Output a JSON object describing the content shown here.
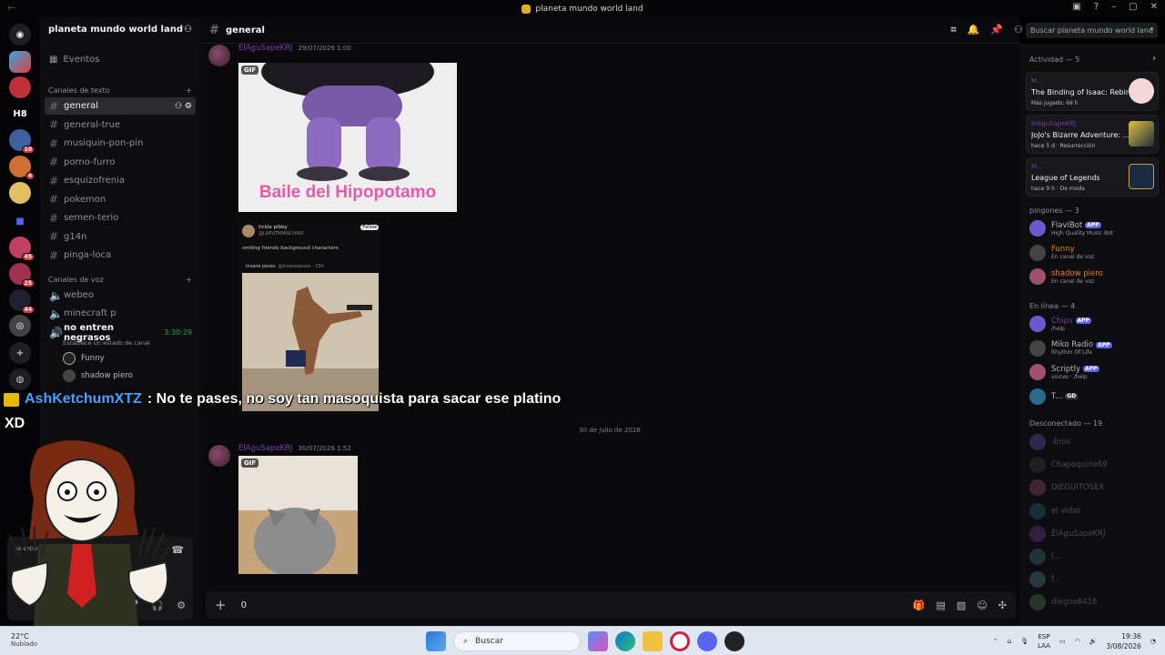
{
  "window": {
    "title": "planeta mundo world land"
  },
  "server": {
    "name": "planeta mundo world land",
    "events_label": "Eventos",
    "text_category": "Canales de texto",
    "voice_category": "Canales de voz",
    "text_channels": [
      "general",
      "general-true",
      "musiquin-pon-pin",
      "porno-furro",
      "esquizofrenia",
      "pokemon",
      "semen-terio",
      "g14n",
      "pinga-loca"
    ],
    "voice_channels": [
      "webeo",
      "minecraft p",
      "no entren negrasos"
    ],
    "active_voice": {
      "name": "no entren negrasos",
      "timer": "3:30:29",
      "status_hint": "Establece un estado de canal",
      "users": [
        "Funny",
        "shadow piero"
      ]
    },
    "rail_labels": {
      "h8": "H8",
      "b10": "10",
      "b4": "4",
      "b45": "45",
      "b25": "25",
      "b44": "44"
    }
  },
  "channel_header": {
    "name": "general",
    "search_placeholder": "Buscar planeta mundo world land"
  },
  "messages": [
    {
      "author": "ElAguSapeKRJ",
      "timestamp": "29/07/2026 1:00",
      "gif_label": "GIF",
      "gif_caption": "Baile del Hipopotamo"
    },
    {
      "embed_user": "tickle pibby",
      "embed_handle": "@LAPUTAPANCHIKO",
      "embed_text": "smiling friends background characters",
      "embed_quote_user": "insane poses",
      "embed_quote_handle": "@insaneposes · 23h",
      "follow": "Follow"
    },
    {
      "date_divider": "30 de julio de 2026"
    },
    {
      "author": "ElAguSapeKRJ",
      "timestamp": "30/07/2026 1:52",
      "gif_label": "GIF"
    }
  ],
  "composer": {
    "value": "0"
  },
  "overlay": {
    "user": "AshKetchumXTZ",
    "message": ": No te pases, no soy tan masoquista para sacar ese platino",
    "second_line": "XD"
  },
  "user_panel": {
    "channel_line": "no entren ... mundo"
  },
  "activity": {
    "header": "Actividad — 5",
    "cards": [
      {
        "who": "M...",
        "game": "The Binding of Isaac: Rebirth",
        "sub": "Más jugado: 66 h"
      },
      {
        "who": "ElAguSapeKRJ",
        "game": "JoJo's Bizarre Adventure: ...",
        "sub": "hace 5 d  ·  Resurrección"
      },
      {
        "who": "M...",
        "game": "League of Legends",
        "sub": "hace 9 h  ·  De moda"
      }
    ]
  },
  "member_groups": {
    "pingones_header": "pingones — 3",
    "pingones": [
      {
        "name": "FlaviBot",
        "status": "High Quality Music Bot",
        "app": "APP",
        "color": "#b5bac1"
      },
      {
        "name": "Funny",
        "status": "En canal de voz",
        "color": "#e67e22"
      },
      {
        "name": "shadow piero",
        "status": "En canal de voz",
        "color": "#e67e22"
      }
    ],
    "online_header": "En línea — 4",
    "online": [
      {
        "name": "Chips",
        "status": "/help",
        "app": "APP",
        "color": "#7d3ba8"
      },
      {
        "name": "Miko Radio",
        "status": "Rhythm Of Life",
        "app": "APP",
        "color": "#b5bac1"
      },
      {
        "name": "Scriptly",
        "status": "voices · /help",
        "app": "APP",
        "color": "#b5bac1"
      },
      {
        "name": "T...",
        "status": "",
        "tag": "GD",
        "color": "#b5bac1"
      }
    ],
    "offline_header": "Desconectado — 19",
    "offline": [
      ".Eros",
      "Chapaquina69",
      "DIEGUITOSEX",
      "el vidas",
      "ElAguSapeKRJ",
      "l... ",
      "f...",
      "diegoo8418"
    ]
  },
  "taskbar": {
    "weather_temp": "22°C",
    "weather_desc": "Nublado",
    "search": "Buscar",
    "lang": "ESP",
    "lang2": "LAA",
    "time": "19:36",
    "date": "3/08/2026"
  },
  "colors": {
    "accent": "#5865f2",
    "author": "#7d3ba8",
    "voice_user": "#e67e22",
    "overlay_user": "#3ea6ff"
  }
}
